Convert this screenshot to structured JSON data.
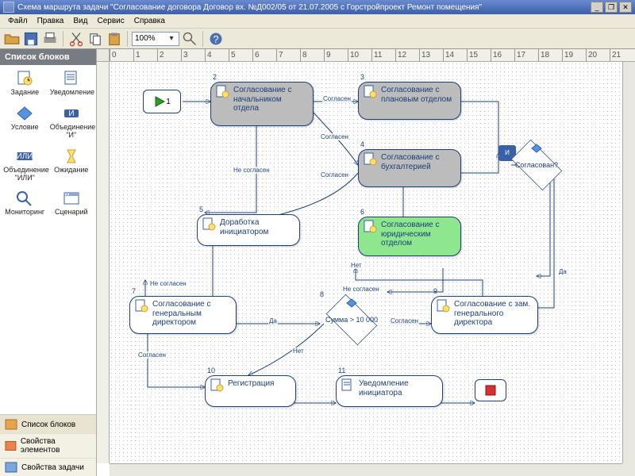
{
  "window": {
    "title": "Схема маршрута задачи \"Согласование договора Договор вх. №Д002/05 от 21.07.2005 с Горстройпроект Ремонт помещения\""
  },
  "menu": {
    "file": "Файл",
    "edit": "Правка",
    "view": "Вид",
    "service": "Сервис",
    "help": "Справка"
  },
  "toolbar": {
    "zoom": "100%"
  },
  "sidebar": {
    "title": "Список блоков",
    "items": [
      {
        "label": "Задание",
        "icon": "task"
      },
      {
        "label": "Уведомление",
        "icon": "notify"
      },
      {
        "label": "Условие",
        "icon": "condition"
      },
      {
        "label": "Объединение \"И\"",
        "icon": "and"
      },
      {
        "label": "Объединение \"ИЛИ\"",
        "icon": "or"
      },
      {
        "label": "Ожидание",
        "icon": "wait"
      },
      {
        "label": "Мониторинг",
        "icon": "monitor"
      },
      {
        "label": "Сценарий",
        "icon": "script"
      }
    ],
    "accordion": [
      {
        "label": "Список блоков"
      },
      {
        "label": "Свойства элементов"
      },
      {
        "label": "Свойства задачи"
      }
    ]
  },
  "ruler": [
    "0",
    "1",
    "2",
    "3",
    "4",
    "5",
    "6",
    "7",
    "8",
    "9",
    "10",
    "11",
    "12",
    "13",
    "14",
    "15",
    "16",
    "17",
    "18",
    "19",
    "20",
    "21"
  ],
  "nodes": {
    "n1": {
      "num": "1",
      "text": ""
    },
    "n2": {
      "num": "2",
      "text": "Согласование с начальником отдела"
    },
    "n3": {
      "num": "3",
      "text": "Согласование с плановым отделом"
    },
    "n4": {
      "num": "4",
      "text": "Согласование с бухгалтерией"
    },
    "n5": {
      "num": "5",
      "text": "Доработка инициатором"
    },
    "n6": {
      "num": "6",
      "text": "Согласование с юридическим отделом"
    },
    "n7": {
      "num": "7",
      "text": "Согласование с генеральным директором"
    },
    "n8": {
      "num": "8",
      "text": "Сумма > 10 000"
    },
    "n9": {
      "num": "9",
      "text": "Согласование с зам. генерального директора"
    },
    "n10": {
      "num": "10",
      "text": "Регистрация"
    },
    "n11": {
      "num": "11",
      "text": "Уведомление инициатора"
    },
    "d1": {
      "text": "Согласован?"
    }
  },
  "labels": {
    "agree": "Согласен",
    "notagree": "Не согласен",
    "yes": "Да",
    "no": "Нет"
  }
}
